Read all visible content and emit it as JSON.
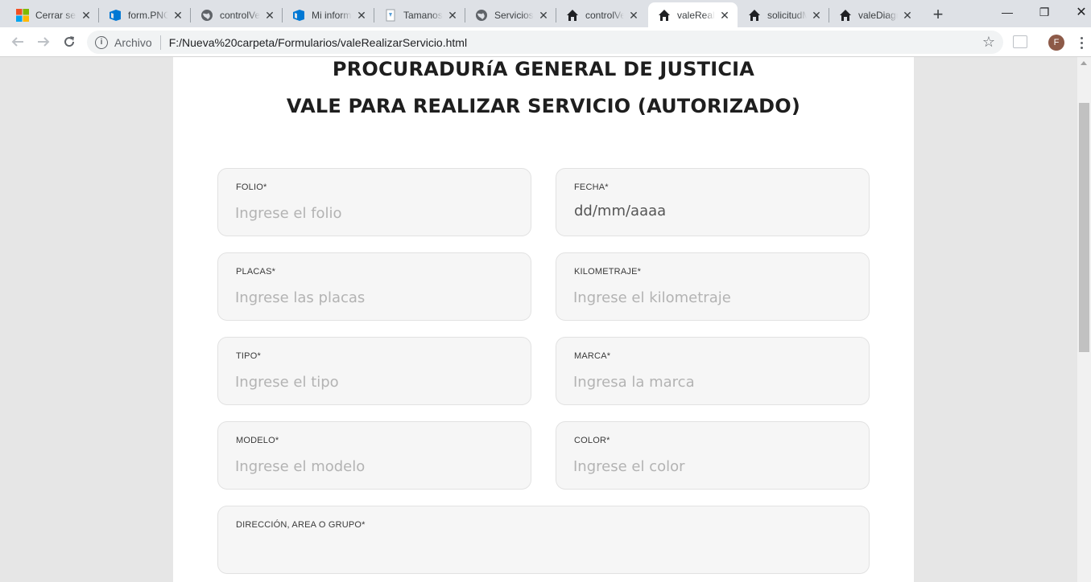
{
  "browser": {
    "tabs": [
      {
        "label": "Cerrar sesión",
        "icon": "microsoft-logo-icon"
      },
      {
        "label": "form.PNG",
        "icon": "azure-devops-icon"
      },
      {
        "label": "controlVehicular",
        "icon": "globe-icon"
      },
      {
        "label": "Mi informe",
        "icon": "azure-devops-icon"
      },
      {
        "label": "Tamanos",
        "icon": "document-icon"
      },
      {
        "label": "Servicios",
        "icon": "globe-icon"
      },
      {
        "label": "controlVehiculos",
        "icon": "home-icon"
      },
      {
        "label": "valeRealizarServicio",
        "icon": "home-icon",
        "active": true
      },
      {
        "label": "solicitudMantenimiento",
        "icon": "home-icon"
      },
      {
        "label": "valeDiagnostico",
        "icon": "home-icon"
      }
    ],
    "new_tab": "+",
    "window": {
      "minimize": "—",
      "restore": "❐",
      "close": "✕"
    },
    "address": {
      "scheme_label": "Archivo",
      "url": "F:/Nueva%20carpeta/Formularios/valeRealizarServicio.html"
    },
    "profile_initial": "F"
  },
  "form": {
    "title_line1": "PROCURADURíA GENERAL DE JUSTICIA",
    "title_line2": "VALE PARA REALIZAR SERVICIO (AUTORIZADO)",
    "fields": {
      "folio": {
        "label": "FOLIO*",
        "placeholder": "Ingrese el folio"
      },
      "fecha": {
        "label": "FECHA*",
        "value": "dd/mm/aaaa"
      },
      "placas": {
        "label": "PLACAS*",
        "placeholder": "Ingrese las placas"
      },
      "kilometraje": {
        "label": "KILOMETRAJE*",
        "placeholder": "Ingrese el kilometraje"
      },
      "tipo": {
        "label": "TIPO*",
        "placeholder": "Ingrese el tipo"
      },
      "marca": {
        "label": "MARCA*",
        "placeholder": "Ingresa la marca"
      },
      "modelo": {
        "label": "MODELO*",
        "placeholder": "Ingrese el modelo"
      },
      "color": {
        "label": "COLOR*",
        "placeholder": "Ingrese el color"
      },
      "direccion": {
        "label": "DIRECCIÓN, AREA O GRUPO*",
        "placeholder": ""
      }
    }
  }
}
